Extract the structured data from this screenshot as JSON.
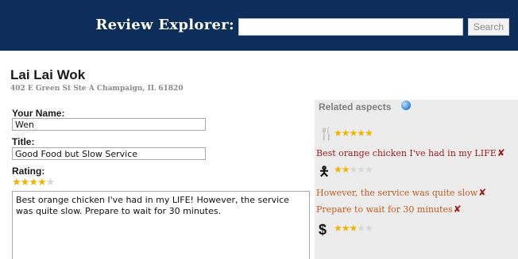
{
  "header": {
    "title": "Review Explorer:",
    "search_value": "",
    "search_button": "Search"
  },
  "business": {
    "name": "Lai Lai Wok",
    "address": "402 E Green St Ste A Champaign, IL 61820"
  },
  "form": {
    "name_label": "Your Name:",
    "name_value": "Wen",
    "title_label": "Title:",
    "title_value": "Good Food but Slow Service",
    "rating_label": "Rating:",
    "rating": 4,
    "rating_max": 5,
    "review_text": "Best orange chicken I've had in my LIFE! However, the service was quite slow. Prepare to wait for 30 minutes."
  },
  "aspects": {
    "title": "Related aspects",
    "items": [
      {
        "icon": "fork-knife-icon",
        "glyph": "🍴",
        "rating": 5,
        "snippets": [
          "Best orange chicken I've had in my LIFE"
        ]
      },
      {
        "icon": "waiter-icon",
        "glyph": "🯅",
        "rating": 2,
        "snippets": [
          "However, the service was quite slow",
          "Prepare to wait for 30 minutes"
        ]
      },
      {
        "icon": "dollar-icon",
        "glyph": "$",
        "rating": 3,
        "snippets": []
      }
    ],
    "remove_glyph": "✘"
  },
  "colors": {
    "header_bg": "#0d2d5b",
    "panel_bg": "#ececec",
    "star_on": "#f1b300",
    "snippet_dark": "#a01a1a",
    "snippet_orange": "#c45a1f"
  }
}
